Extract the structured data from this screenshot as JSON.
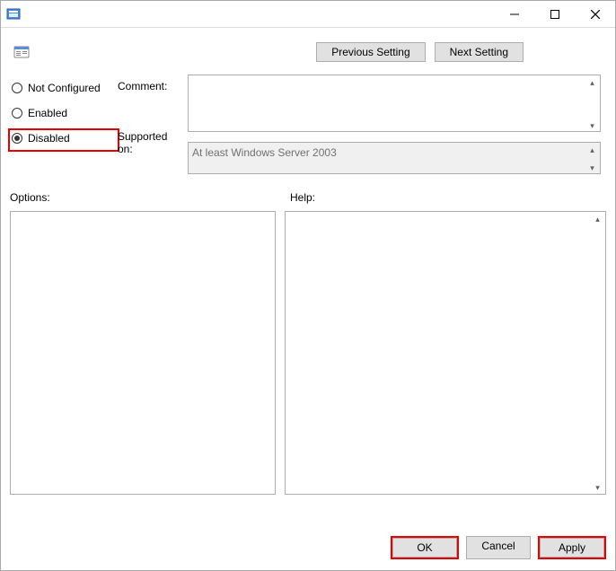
{
  "window": {
    "title": ""
  },
  "nav": {
    "previous": "Previous Setting",
    "next": "Next Setting"
  },
  "radios": {
    "not_configured": "Not Configured",
    "enabled": "Enabled",
    "disabled": "Disabled",
    "selected": "disabled"
  },
  "labels": {
    "comment": "Comment:",
    "supported": "Supported on:",
    "options": "Options:",
    "help": "Help:"
  },
  "fields": {
    "comment": "",
    "supported": "At least Windows Server 2003",
    "options": "",
    "help": ""
  },
  "buttons": {
    "ok": "OK",
    "cancel": "Cancel",
    "apply": "Apply"
  }
}
